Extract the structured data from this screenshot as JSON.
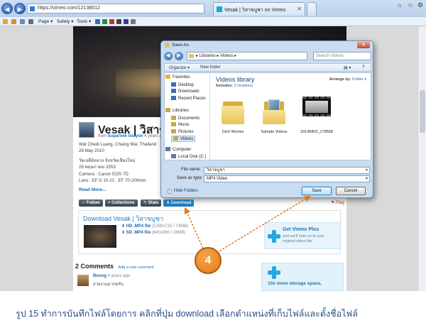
{
  "browser": {
    "url": "https://vimeo.com/12138012",
    "tab_title": "Vesak | วิสาขบูชา on Vimeo",
    "toolbar": {
      "page": "Page ▾",
      "safety": "Safety ▾",
      "tools": "Tools ▾"
    }
  },
  "video": {
    "title": "Vesak | วิสาข",
    "by_prefix": "from",
    "author": "Suparoek Isiayon",
    "ago": "4 years ago",
    "desc_lines": [
      "Wat Chedi Luang, Chiang Mai, Thailand",
      "28 May 2010",
      "วัดเจดีย์หลวง จังหวัดเชียงใหม่",
      "28 พฤษภาคม 2553",
      "Camera : Canon EOS 7D",
      "Lens : EF-S 10-22 , EF 70-200mm"
    ],
    "read_more": "Read More...",
    "actions": [
      "✓ Follow",
      "+ Collections",
      "✎ Stats",
      "⬇ Download"
    ],
    "flag": "⚑ Flag"
  },
  "download_box": {
    "heading": "Download Vesak | วิสาขบูชา",
    "options": [
      {
        "label": "HD .MP4 file",
        "meta": "(1280x720 / 74MB)"
      },
      {
        "label": "SD .MP4 file",
        "meta": "(640x360 / 24MB)"
      }
    ],
    "plus_title": "Get Vimeo Plus",
    "plus_desc": [
      "and we'll hold on to your",
      "original video file."
    ]
  },
  "comments": {
    "title": "2 Comments",
    "add_link": "Add a new comment",
    "user": "Boong",
    "ago": "4 years ago",
    "text": "สวยงามมากครับ"
  },
  "ad": {
    "plus_text": "10x more storage space,"
  },
  "save_dialog": {
    "title": "Save As",
    "close": "✕",
    "path": "▸ Libraries ▸ Videos ▸",
    "search_placeholder": "Search Videos",
    "toolbar": {
      "organize": "Organize ▾",
      "new_folder": "New folder"
    },
    "tree": [
      {
        "label": "Favorites",
        "icon": "star-icon",
        "color": "#e6b73a"
      },
      {
        "label": "Desktop",
        "icon": "desktop-icon",
        "color": "#3a6fb5"
      },
      {
        "label": "Downloads",
        "icon": "downloads-icon",
        "color": "#3a6fb5"
      },
      {
        "label": "Recent Places",
        "icon": "recent-places-icon",
        "color": "#3a6fb5"
      },
      {
        "label": "Libraries",
        "icon": "libraries-icon",
        "color": "#c9a84a"
      },
      {
        "label": "Documents",
        "icon": "documents-icon",
        "color": "#c9a84a"
      },
      {
        "label": "Music",
        "icon": "music-icon",
        "color": "#c9a84a"
      },
      {
        "label": "Pictures",
        "icon": "pictures-icon",
        "color": "#c9a84a"
      },
      {
        "label": "Videos",
        "icon": "videos-icon",
        "color": "#c9a84a"
      },
      {
        "label": "Computer",
        "icon": "computer-icon",
        "color": "#5f7a98"
      },
      {
        "label": "Local Disk (C:)",
        "icon": "disk-icon",
        "color": "#5f7a98"
      }
    ],
    "library_title": "Videos library",
    "includes_prefix": "Includes:",
    "includes_link": "2 locations",
    "arrange_prefix": "Arrange by:",
    "arrange_value": "Folder ▾",
    "files": [
      "DivX Movies",
      "Sample Videos",
      "20140802_178558"
    ],
    "file_name_label": "File name:",
    "file_name_value": "วิสาขบูชา",
    "save_type_label": "Save as type:",
    "save_type_value": "MP4 Video",
    "hide_folders": "Hide Folders",
    "save_button": "Save",
    "cancel_button": "Cancel"
  },
  "annotation": {
    "step": "4"
  },
  "caption": "รูป 15 ทำการบันทึกไฟล์โดยการ คลิกที่ปุ่ม download เลือกตำแหน่งที่เก็บไฟล์และตั้งชื่อไฟล์"
}
